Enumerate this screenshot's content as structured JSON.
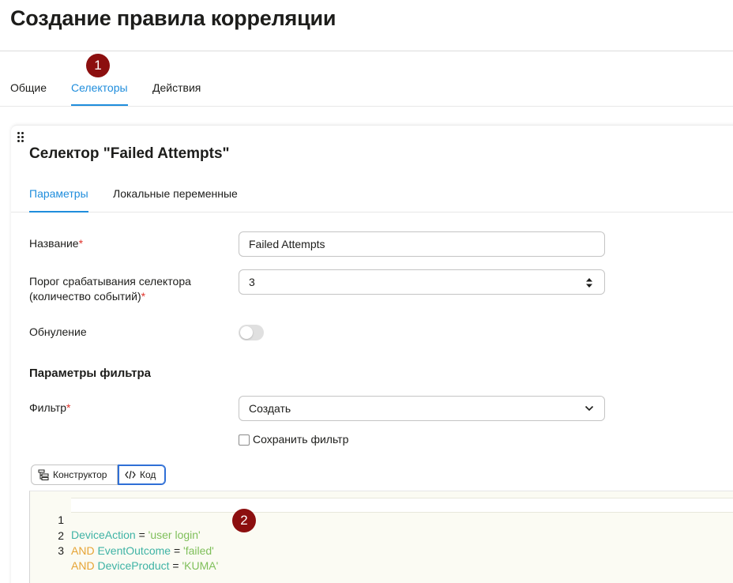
{
  "page": {
    "title": "Создание правила корреляции"
  },
  "main_tabs": [
    {
      "label": "Общие"
    },
    {
      "label": "Селекторы"
    },
    {
      "label": "Действия"
    }
  ],
  "markers": {
    "m1": "1",
    "m2": "2"
  },
  "selector": {
    "title": "Селектор \"Failed Attempts\"",
    "tabs": [
      {
        "label": "Параметры"
      },
      {
        "label": "Локальные переменные"
      }
    ],
    "form": {
      "name_label": "Название",
      "name_value": "Failed Attempts",
      "threshold_label_line1": "Порог срабатывания селектора",
      "threshold_label_line2": "(количество событий)",
      "threshold_value": "3",
      "reset_label": "Обнуление",
      "reset_enabled": false,
      "required_mark": "*"
    },
    "filter": {
      "section_title": "Параметры фильтра",
      "filter_label": "Фильтр",
      "filter_value": "Создать",
      "save_filter_label": "Сохранить фильтр",
      "save_filter_checked": false
    },
    "editor_modes": {
      "constructor": "Конструктор",
      "code": "Код",
      "active": "code"
    },
    "code_lines": [
      {
        "num": "1",
        "keyword": "",
        "field": "DeviceAction",
        "op": " = ",
        "value": "'user login'"
      },
      {
        "num": "2",
        "keyword": "AND ",
        "field": "EventOutcome",
        "op": " = ",
        "value": "'failed'"
      },
      {
        "num": "3",
        "keyword": "AND ",
        "field": "DeviceProduct",
        "op": " = ",
        "value": "'KUMA'"
      }
    ]
  },
  "colors": {
    "accent": "#1f8ddc",
    "marker": "#8c0f0f",
    "required": "#e0332b",
    "keyword": "#e6a435",
    "field": "#3fb3a5",
    "string": "#7fbf5a"
  },
  "icons": {
    "drag": "drag-handle-icon",
    "stepper": "stepper-arrows-icon",
    "chevron": "chevron-down-icon",
    "constructor": "tree-structure-icon",
    "code": "code-brackets-icon"
  }
}
